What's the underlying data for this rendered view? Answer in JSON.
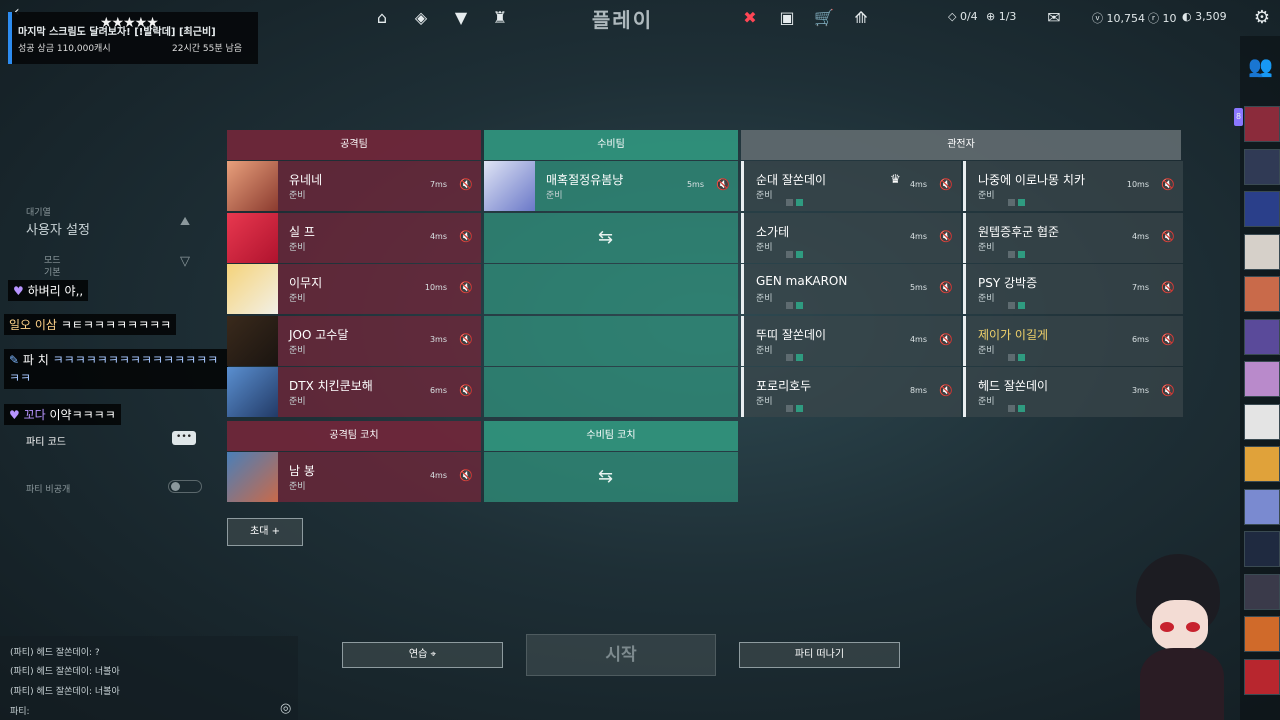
{
  "topbar": {
    "title": "플레이",
    "icons": [
      "home-icon",
      "career-icon",
      "collection-icon",
      "battlepass-icon",
      "agents-icon",
      "store-icon",
      "premier-icon",
      "rank-icon"
    ],
    "missions": "0/4",
    "weekly": "1/3",
    "vp": "10,754",
    "radianite": "10",
    "kingdom": "3,509"
  },
  "promo": {
    "stars": "★★★★★",
    "title": "마지막 스크림도 달려보자! [!발락데] [최근비]",
    "sub_left": "성공 상금 110,000캐시",
    "sub_right": "22시간 55분 남음"
  },
  "sidebar": {
    "lobby_label": "대기열",
    "settings": "사용자 설정",
    "mode_label": "모드",
    "mode_value": "기본",
    "party_code": "파티 코드",
    "party_private": "파티 비공개"
  },
  "chat_overlay": [
    {
      "user": "하벼리",
      "text": "야,,"
    },
    {
      "user": "일오 이삼",
      "text": "ㅋㅌㅋㅋㅋㅋㅋㅋㅋㅋ"
    },
    {
      "user": "파 치",
      "text": "ㅋㅋㅋㅋㅋㅋㅋㅋㅋㅋㅋㅋㅋㅋㅋㅋㅋ"
    },
    {
      "user": "꼬다",
      "text": "이약ㅋㅋㅋㅋ"
    }
  ],
  "party_chat": [
    {
      "text": "(파티) 헤드 잘쏜데이: ?"
    },
    {
      "text": "(파티) 헤드 잘쏜데이: 너볼아"
    },
    {
      "text": "(파티) 헤드 잘쏜데이: 너볼아"
    }
  ],
  "party_input_label": "파티:",
  "teams": {
    "attack_header": "공격팀",
    "defense_header": "수비팀",
    "spectator_header": "관전자",
    "attack_coach_header": "공격팀 코치",
    "defense_coach_header": "수비팀 코치",
    "ready": "준비",
    "attack": [
      {
        "name": "유네네",
        "ping": "7ms"
      },
      {
        "name": "실 프",
        "ping": "4ms"
      },
      {
        "name": "이무지",
        "ping": "10ms"
      },
      {
        "name": "JOO 고수달",
        "ping": "3ms"
      },
      {
        "name": "DTX 치킨쿤보해",
        "ping": "6ms"
      }
    ],
    "defense": [
      {
        "name": "매혹절정유봄냥",
        "ping": "5ms"
      }
    ],
    "spectators_left": [
      {
        "name": "순대 잘쏜데이",
        "ping": "4ms"
      },
      {
        "name": "소가테",
        "ping": "4ms"
      },
      {
        "name": "GEN maKARON",
        "ping": "5ms"
      },
      {
        "name": "뚜띠 잘쏜데이",
        "ping": "4ms"
      },
      {
        "name": "포로리호두",
        "ping": "8ms"
      }
    ],
    "spectators_right": [
      {
        "name": "나중에 이로나몽 치카",
        "ping": "10ms"
      },
      {
        "name": "원텝증후군 협준",
        "ping": "4ms"
      },
      {
        "name": "PSY 강박증",
        "ping": "7ms"
      },
      {
        "name": "제이가 이길게",
        "ping": "6ms"
      },
      {
        "name": "헤드 잘쏜데이",
        "ping": "3ms"
      }
    ],
    "attack_coach": {
      "name": "남 봉",
      "ping": "4ms"
    }
  },
  "buttons": {
    "invite": "초대",
    "practice": "연습",
    "start": "시작",
    "leave": "파티 떠나기"
  },
  "colors": {
    "attack": "#6f273a",
    "defense": "#30927c",
    "spectator": "#3a464b",
    "highlight_name": "#f2d36b"
  }
}
